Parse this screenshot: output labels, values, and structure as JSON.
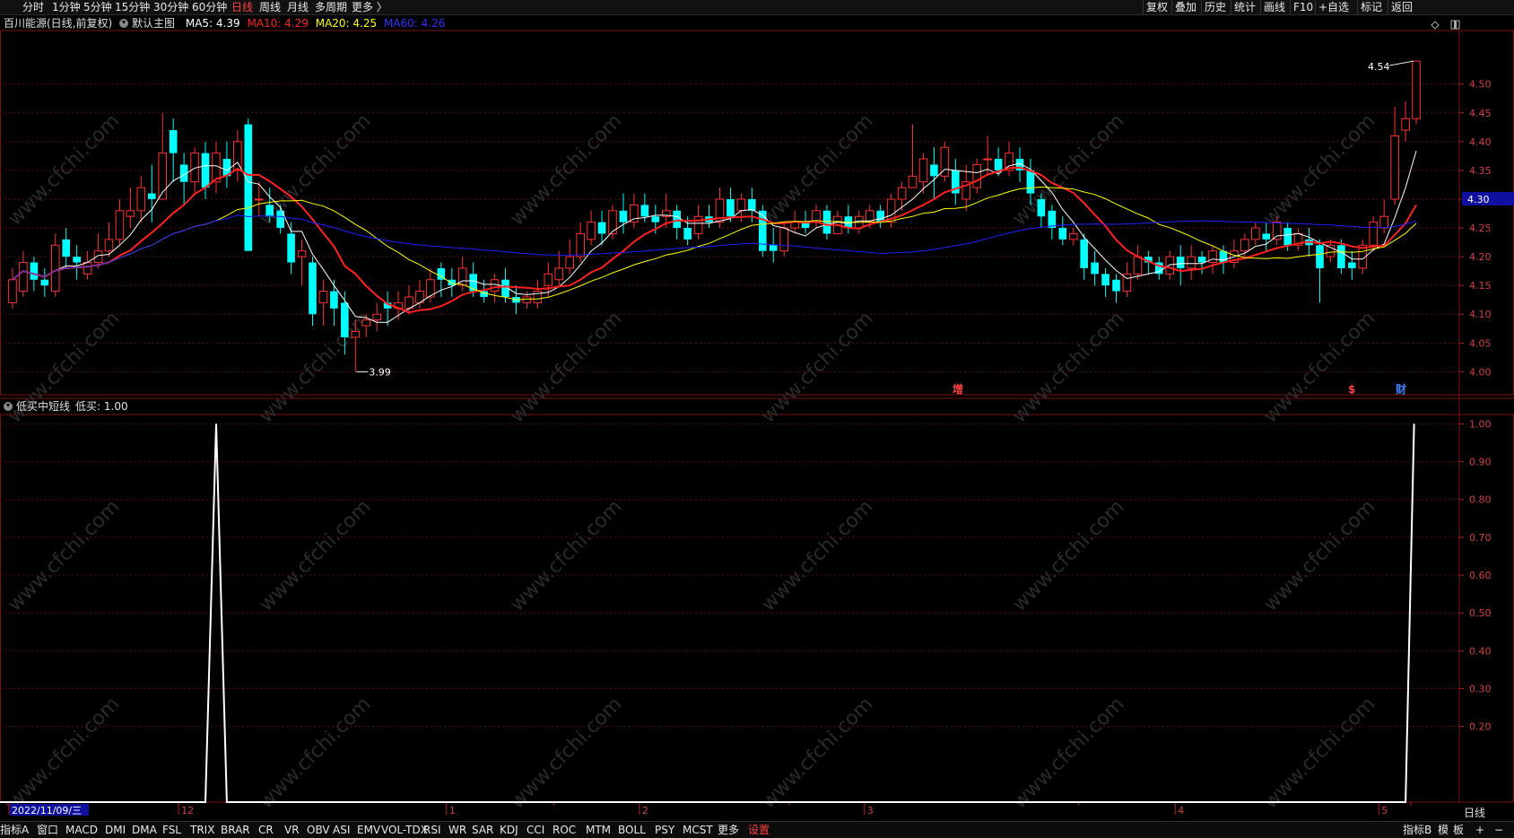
{
  "toolbar": {
    "periods": [
      "分时",
      "1分钟",
      "5分钟",
      "15分钟",
      "30分钟",
      "60分钟",
      "日线",
      "周线",
      "月线",
      "多周期",
      "更多 〉"
    ],
    "active_period": "日线",
    "right_buttons": [
      "复权",
      "叠加",
      "历史",
      "统计",
      "画线",
      "F10",
      "+自选",
      "标记",
      "返回"
    ]
  },
  "main_panel": {
    "stock_title": "百川能源(日线,前复权)",
    "template_label": "默认主图",
    "ma_legend": [
      {
        "label": "MA5: 4.39",
        "color": "#ffffff"
      },
      {
        "label": "MA10: 4.29",
        "color": "#ff2020"
      },
      {
        "label": "MA20: 4.25",
        "color": "#ffff00"
      },
      {
        "label": "MA60: 4.26",
        "color": "#2020ff"
      }
    ],
    "high_marker": "4.54",
    "low_marker": "3.99",
    "price_tag": "4.30",
    "event_marks": [
      {
        "text": "增",
        "color": "#ff4040"
      },
      {
        "text": "$",
        "color": "#ff4040"
      },
      {
        "text": "财",
        "color": "#4080ff"
      }
    ]
  },
  "indicator_panel": {
    "title": "低买中短线",
    "value_label": "低买: 1.00"
  },
  "watermark": "www.cfchi.com",
  "chart_data": [
    {
      "type": "candlestick",
      "title": "百川能源(日线,前复权)",
      "ylim": [
        3.96,
        4.59
      ],
      "y_ticks": [
        "4.50",
        "4.45",
        "4.40",
        "4.35",
        "4.30",
        "4.25",
        "4.20",
        "4.15",
        "4.10",
        "4.05",
        "4.00"
      ],
      "x_ticks": [
        "2022/11/09/三",
        "12",
        "1",
        "2",
        "3",
        "4",
        "5"
      ],
      "candles": [
        [
          4.12,
          4.16,
          4.18,
          4.11
        ],
        [
          4.14,
          4.19,
          4.21,
          4.13
        ],
        [
          4.19,
          4.16,
          4.2,
          4.14
        ],
        [
          4.16,
          4.15,
          4.18,
          4.13
        ],
        [
          4.14,
          4.22,
          4.24,
          4.13
        ],
        [
          4.23,
          4.2,
          4.25,
          4.18
        ],
        [
          4.2,
          4.19,
          4.22,
          4.16
        ],
        [
          4.17,
          4.19,
          4.21,
          4.16
        ],
        [
          4.19,
          4.21,
          4.24,
          4.18
        ],
        [
          4.21,
          4.23,
          4.26,
          4.2
        ],
        [
          4.23,
          4.28,
          4.3,
          4.22
        ],
        [
          4.27,
          4.28,
          4.32,
          4.25
        ],
        [
          4.28,
          4.32,
          4.34,
          4.26
        ],
        [
          4.31,
          4.3,
          4.36,
          4.26
        ],
        [
          4.3,
          4.38,
          4.45,
          4.3
        ],
        [
          4.42,
          4.38,
          4.44,
          4.33
        ],
        [
          4.36,
          4.33,
          4.38,
          4.29
        ],
        [
          4.33,
          4.38,
          4.39,
          4.31
        ],
        [
          4.38,
          4.32,
          4.4,
          4.3
        ],
        [
          4.33,
          4.38,
          4.4,
          4.31
        ],
        [
          4.37,
          4.34,
          4.4,
          4.32
        ],
        [
          4.35,
          4.4,
          4.42,
          4.33
        ],
        [
          4.43,
          4.21,
          4.44,
          4.21
        ],
        [
          4.3,
          4.3,
          4.33,
          4.27
        ],
        [
          4.29,
          4.27,
          4.32,
          4.26
        ],
        [
          4.28,
          4.25,
          4.29,
          4.24
        ],
        [
          4.24,
          4.19,
          4.26,
          4.17
        ],
        [
          4.2,
          4.21,
          4.23,
          4.15
        ],
        [
          4.19,
          4.1,
          4.2,
          4.08
        ],
        [
          4.12,
          4.14,
          4.16,
          4.08
        ],
        [
          4.14,
          4.11,
          4.16,
          4.08
        ],
        [
          4.12,
          4.06,
          4.14,
          4.03
        ],
        [
          4.06,
          4.07,
          4.09,
          4.0
        ],
        [
          4.08,
          4.09,
          4.1,
          4.06
        ],
        [
          4.09,
          4.1,
          4.12,
          4.07
        ],
        [
          4.12,
          4.11,
          4.14,
          4.08
        ],
        [
          4.11,
          4.12,
          4.14,
          4.09
        ],
        [
          4.11,
          4.13,
          4.15,
          4.1
        ],
        [
          4.12,
          4.14,
          4.16,
          4.11
        ],
        [
          4.13,
          4.16,
          4.18,
          4.12
        ],
        [
          4.18,
          4.16,
          4.19,
          4.13
        ],
        [
          4.16,
          4.15,
          4.18,
          4.13
        ],
        [
          4.15,
          4.18,
          4.2,
          4.14
        ],
        [
          4.17,
          4.14,
          4.19,
          4.13
        ],
        [
          4.14,
          4.13,
          4.16,
          4.12
        ],
        [
          4.14,
          4.16,
          4.17,
          4.12
        ],
        [
          4.16,
          4.13,
          4.18,
          4.12
        ],
        [
          4.13,
          4.12,
          4.15,
          4.1
        ],
        [
          4.12,
          4.13,
          4.14,
          4.11
        ],
        [
          4.12,
          4.14,
          4.16,
          4.11
        ],
        [
          4.15,
          4.17,
          4.19,
          4.13
        ],
        [
          4.16,
          4.18,
          4.21,
          4.15
        ],
        [
          4.18,
          4.2,
          4.23,
          4.17
        ],
        [
          4.2,
          4.24,
          4.26,
          4.19
        ],
        [
          4.23,
          4.26,
          4.28,
          4.22
        ],
        [
          4.26,
          4.24,
          4.28,
          4.22
        ],
        [
          4.24,
          4.28,
          4.29,
          4.23
        ],
        [
          4.28,
          4.26,
          4.31,
          4.24
        ],
        [
          4.26,
          4.29,
          4.31,
          4.25
        ],
        [
          4.29,
          4.27,
          4.31,
          4.26
        ],
        [
          4.27,
          4.26,
          4.29,
          4.24
        ],
        [
          4.27,
          4.28,
          4.31,
          4.25
        ],
        [
          4.28,
          4.25,
          4.29,
          4.23
        ],
        [
          4.25,
          4.23,
          4.27,
          4.22
        ],
        [
          4.24,
          4.27,
          4.29,
          4.23
        ],
        [
          4.27,
          4.26,
          4.29,
          4.25
        ],
        [
          4.26,
          4.3,
          4.32,
          4.25
        ],
        [
          4.3,
          4.27,
          4.32,
          4.26
        ],
        [
          4.28,
          4.3,
          4.31,
          4.26
        ],
        [
          4.3,
          4.28,
          4.32,
          4.26
        ],
        [
          4.28,
          4.21,
          4.29,
          4.2
        ],
        [
          4.22,
          4.21,
          4.25,
          4.19
        ],
        [
          4.21,
          4.25,
          4.26,
          4.2
        ],
        [
          4.25,
          4.26,
          4.28,
          4.24
        ],
        [
          4.26,
          4.25,
          4.28,
          4.24
        ],
        [
          4.26,
          4.28,
          4.29,
          4.25
        ],
        [
          4.28,
          4.24,
          4.29,
          4.23
        ],
        [
          4.24,
          4.27,
          4.28,
          4.24
        ],
        [
          4.27,
          4.25,
          4.29,
          4.24
        ],
        [
          4.25,
          4.27,
          4.28,
          4.24
        ],
        [
          4.26,
          4.28,
          4.29,
          4.25
        ],
        [
          4.28,
          4.26,
          4.29,
          4.25
        ],
        [
          4.26,
          4.3,
          4.31,
          4.25
        ],
        [
          4.3,
          4.32,
          4.33,
          4.28
        ],
        [
          4.32,
          4.34,
          4.43,
          4.32
        ],
        [
          4.33,
          4.37,
          4.38,
          4.31
        ],
        [
          4.36,
          4.34,
          4.39,
          4.3
        ],
        [
          4.34,
          4.39,
          4.4,
          4.33
        ],
        [
          4.35,
          4.31,
          4.37,
          4.29
        ],
        [
          4.3,
          4.33,
          4.36,
          4.28
        ],
        [
          4.32,
          4.36,
          4.37,
          4.31
        ],
        [
          4.37,
          4.37,
          4.41,
          4.34
        ],
        [
          4.37,
          4.35,
          4.39,
          4.34
        ],
        [
          4.35,
          4.38,
          4.4,
          4.34
        ],
        [
          4.37,
          4.35,
          4.39,
          4.33
        ],
        [
          4.35,
          4.31,
          4.37,
          4.29
        ],
        [
          4.3,
          4.27,
          4.31,
          4.25
        ],
        [
          4.28,
          4.25,
          4.29,
          4.23
        ],
        [
          4.25,
          4.23,
          4.27,
          4.22
        ],
        [
          4.23,
          4.24,
          4.25,
          4.22
        ],
        [
          4.23,
          4.18,
          4.24,
          4.16
        ],
        [
          4.19,
          4.17,
          4.21,
          4.15
        ],
        [
          4.17,
          4.15,
          4.18,
          4.13
        ],
        [
          4.16,
          4.14,
          4.17,
          4.12
        ],
        [
          4.14,
          4.17,
          4.19,
          4.13
        ],
        [
          4.17,
          4.2,
          4.22,
          4.16
        ],
        [
          4.2,
          4.19,
          4.21,
          4.17
        ],
        [
          4.19,
          4.17,
          4.2,
          4.16
        ],
        [
          4.17,
          4.2,
          4.21,
          4.16
        ],
        [
          4.2,
          4.18,
          4.22,
          4.15
        ],
        [
          4.18,
          4.2,
          4.22,
          4.16
        ],
        [
          4.2,
          4.19,
          4.21,
          4.17
        ],
        [
          4.19,
          4.21,
          4.22,
          4.17
        ],
        [
          4.21,
          4.19,
          4.22,
          4.17
        ],
        [
          4.19,
          4.21,
          4.23,
          4.18
        ],
        [
          4.21,
          4.23,
          4.24,
          4.2
        ],
        [
          4.23,
          4.25,
          4.26,
          4.22
        ],
        [
          4.24,
          4.23,
          4.26,
          4.21
        ],
        [
          4.23,
          4.26,
          4.27,
          4.22
        ],
        [
          4.25,
          4.22,
          4.26,
          4.21
        ],
        [
          4.22,
          4.24,
          4.25,
          4.21
        ],
        [
          4.23,
          4.22,
          4.25,
          4.2
        ],
        [
          4.22,
          4.18,
          4.23,
          4.12
        ],
        [
          4.2,
          4.22,
          4.23,
          4.19
        ],
        [
          4.22,
          4.18,
          4.23,
          4.17
        ],
        [
          4.19,
          4.18,
          4.21,
          4.16
        ],
        [
          4.18,
          4.22,
          4.23,
          4.17
        ],
        [
          4.22,
          4.26,
          4.27,
          4.21
        ],
        [
          4.25,
          4.27,
          4.3,
          4.24
        ],
        [
          4.3,
          4.41,
          4.46,
          4.29
        ],
        [
          4.42,
          4.44,
          4.47,
          4.4
        ],
        [
          4.44,
          4.54,
          4.54,
          4.43
        ]
      ],
      "series": [
        {
          "name": "MA5",
          "color": "#ffffff",
          "last": 4.39
        },
        {
          "name": "MA10",
          "color": "#ff2020",
          "last": 4.29
        },
        {
          "name": "MA20",
          "color": "#ffff00",
          "last": 4.25
        },
        {
          "name": "MA60",
          "color": "#2020ff",
          "last": 4.26
        }
      ]
    },
    {
      "type": "line",
      "title": "低买中短线",
      "ylim": [
        0.0,
        1.02
      ],
      "y_ticks": [
        "1.00",
        "0.90",
        "0.80",
        "0.70",
        "0.60",
        "0.50",
        "0.40",
        "0.30",
        "0.20"
      ],
      "series": [
        {
          "name": "低买",
          "color": "#ffffff",
          "points": [
            [
              0,
              0
            ],
            [
              13,
              0
            ],
            [
              14,
              1.0
            ],
            [
              15,
              0
            ],
            [
              122,
              0
            ],
            [
              123,
              1.0
            ]
          ]
        }
      ]
    }
  ],
  "bottom_bar": {
    "tabs": [
      "指标A",
      "窗口",
      "MACD",
      "DMI",
      "DMA",
      "FSL",
      "TRIX",
      "BRAR",
      "CR",
      "VR",
      "OBV",
      "ASI",
      "EMV",
      "VOL-TDX",
      "RSI",
      "WR",
      "SAR",
      "KDJ",
      "CCI",
      "ROC",
      "MTM",
      "BOLL",
      "PSY",
      "MCST",
      "更多",
      "设置"
    ],
    "active_tab": "设置",
    "right_tabs": [
      "指标B",
      "模",
      "板",
      "+",
      "−"
    ],
    "period_label": "日线"
  }
}
